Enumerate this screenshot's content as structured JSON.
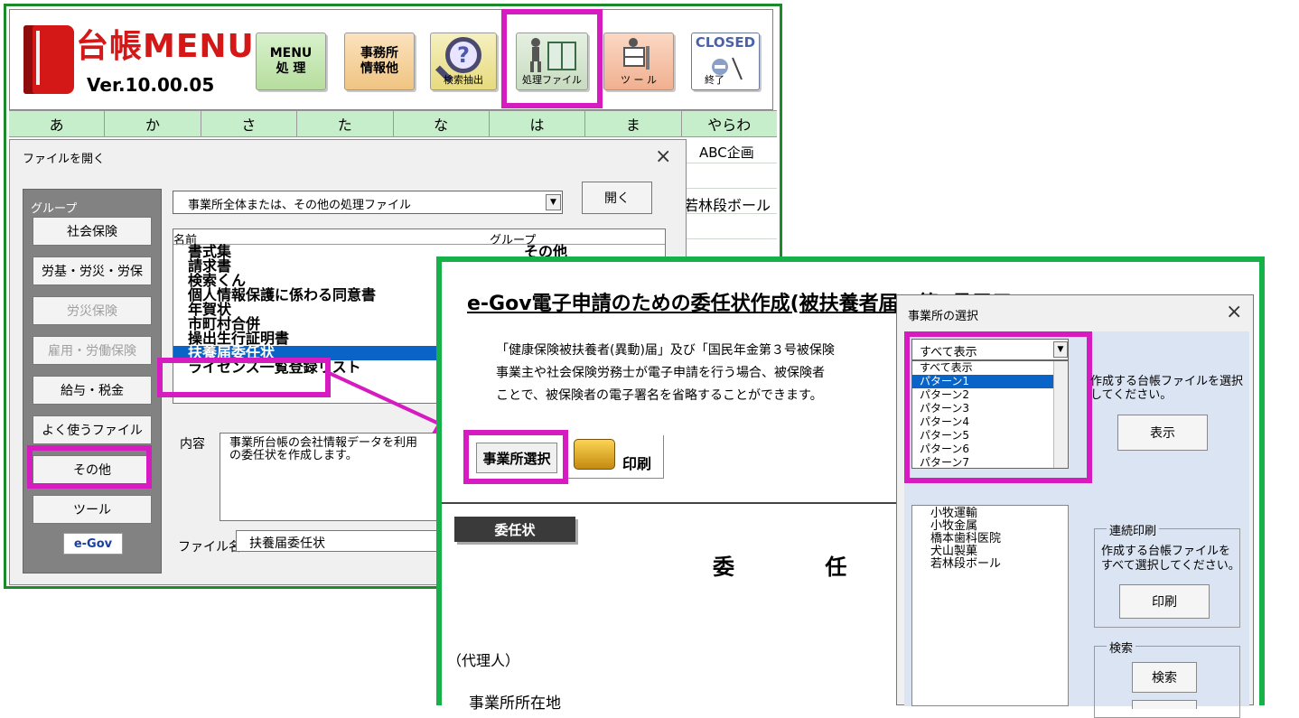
{
  "main_window": {
    "logo_title": "台帳MENU",
    "version": "Ver.10.00.05",
    "toolbar": {
      "menu_label_1": "MENU",
      "menu_label_2": "処 理",
      "office_label_1": "事務所",
      "office_label_2": "情報他",
      "search_label": "検索抽出",
      "process_label": "処理ファイル",
      "tool_label": "ツ ー ル",
      "closed_label": "CLOSED",
      "exit_label": "終了"
    },
    "kana_tabs": [
      "あ",
      "か",
      "さ",
      "た",
      "な",
      "は",
      "ま",
      "やらわ"
    ],
    "rows": {
      "row1": "ABC企画",
      "row2": "若林段ボール"
    }
  },
  "file_dialog": {
    "title": "ファイルを開く",
    "close": "×",
    "group_label": "グループ",
    "groups": [
      "社会保険",
      "労基・労災・労保",
      "労災保険",
      "雇用・労働保険",
      "給与・税金",
      "よく使うファイル",
      "その他",
      "ツール"
    ],
    "egov_badge": "e-Gov",
    "combo_value": "事業所全体または、その他の処理ファイル",
    "open_button": "開く",
    "columns": {
      "name": "名前",
      "group": "グループ"
    },
    "files": [
      "書式集",
      "請求書",
      "検索くん",
      "個人情報保護に係わる同意書",
      "年賀状",
      "市町村合併",
      "操出生行証明書",
      "扶養届委任状",
      "ライセンス一覧登録リスト"
    ],
    "first_group": "その他",
    "content_label": "内容",
    "content_text_1": "事業所台帳の会社情報データを利用",
    "content_text_2": "の委任状を作成します。",
    "filename_label": "ファイル名",
    "filename_value": "扶養届委任状"
  },
  "egov_window": {
    "title": "e-Gov電子申請のための委任状作成(被扶養者届、第3号届用)",
    "desc_1": "「健康保険被扶養者(異動)届」及び「国民年金第３号被保険",
    "desc_2": "事業主や社会保険労務士が電子申請を行う場合、被保険者",
    "desc_3": "ことで、被保険者の電子署名を省略することができます。",
    "office_select_button": "事業所選択",
    "print_button": "印刷",
    "inin_badge": "委任状",
    "inin_heading": "委 任 状",
    "agent_label": "（代理人）",
    "office_address_label": "事業所所在地"
  },
  "office_dialog": {
    "title": "事業所の選択",
    "close": "×",
    "combo_value": "すべて表示",
    "patterns": [
      "すべて表示",
      "パターン1",
      "パターン2",
      "パターン3",
      "パターン4",
      "パターン5",
      "パターン6",
      "パターン7"
    ],
    "selected_pattern_index": 1,
    "offices": [
      "小牧運輸",
      "小牧金属",
      "橋本歯科医院",
      "犬山製菓",
      "若林段ボール"
    ],
    "instruction_1": "作成する台帳ファイルを選択",
    "instruction_2": "してください。",
    "show_button": "表示",
    "serial_legend": "連続印刷",
    "serial_text_1": "作成する台帳ファイルを",
    "serial_text_2": "すべて選択してください。",
    "serial_print_button": "印刷",
    "search_legend": "検索",
    "search_button": "検索"
  },
  "colors": {
    "highlight": "#d61bc0",
    "main_border": "#1a8a2a",
    "egov_border": "#16b148",
    "selection": "#0a64c8"
  }
}
